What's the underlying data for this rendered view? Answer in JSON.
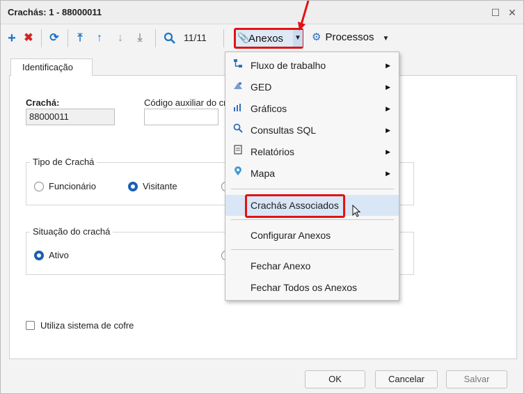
{
  "window": {
    "title": "Crachás: 1 - 88000011",
    "restore_symbol": "☐",
    "close_symbol": "✕"
  },
  "toolbar": {
    "icons": [
      "add-icon",
      "delete-icon",
      "refresh-icon",
      "first-icon",
      "up-icon",
      "down-icon",
      "last-icon",
      "search-icon"
    ],
    "counter": "11/11",
    "anexos_label": "Anexos",
    "processos_label": "Processos"
  },
  "form": {
    "tab_label": "Identificação",
    "cracha_label": "Crachá:",
    "cracha_value": "88000011",
    "codigo_label": "Código auxiliar do cr",
    "codigo_value": "",
    "tipo_legend": "Tipo de Crachá",
    "tipo_options": [
      "Funcionário",
      "Visitante"
    ],
    "tipo_selected": "Visitante",
    "situacao_legend": "Situação do crachá",
    "situacao_options": [
      "Ativo"
    ],
    "situacao_selected": "Ativo",
    "cofre_label": "Utiliza sistema de cofre",
    "cofre_checked": false
  },
  "footer": {
    "ok_label": "OK",
    "cancel_label": "Cancelar",
    "save_label": "Salvar"
  },
  "menu": {
    "items": [
      {
        "label": "Fluxo de trabalho",
        "icon": "workflow-icon",
        "submenu": true
      },
      {
        "label": "GED",
        "icon": "ged-icon",
        "submenu": true
      },
      {
        "label": "Gráficos",
        "icon": "chart-icon",
        "submenu": true
      },
      {
        "label": "Consultas SQL",
        "icon": "search-icon",
        "submenu": true
      },
      {
        "label": "Relatórios",
        "icon": "report-icon",
        "submenu": true
      },
      {
        "label": "Mapa",
        "icon": "map-pin-icon",
        "submenu": true
      },
      {
        "label": "Crachás Associados",
        "icon": "",
        "submenu": false,
        "highlighted": true
      },
      {
        "label": "Configurar Anexos",
        "icon": "",
        "submenu": false
      },
      {
        "label": "Fechar Anexo",
        "icon": "",
        "submenu": false
      },
      {
        "label": "Fechar Todos os Anexos",
        "icon": "",
        "submenu": false
      }
    ]
  },
  "colors": {
    "accent": "#1a73c9",
    "highlight_border": "#e31212",
    "menu_hover": "#d9e6f6"
  }
}
